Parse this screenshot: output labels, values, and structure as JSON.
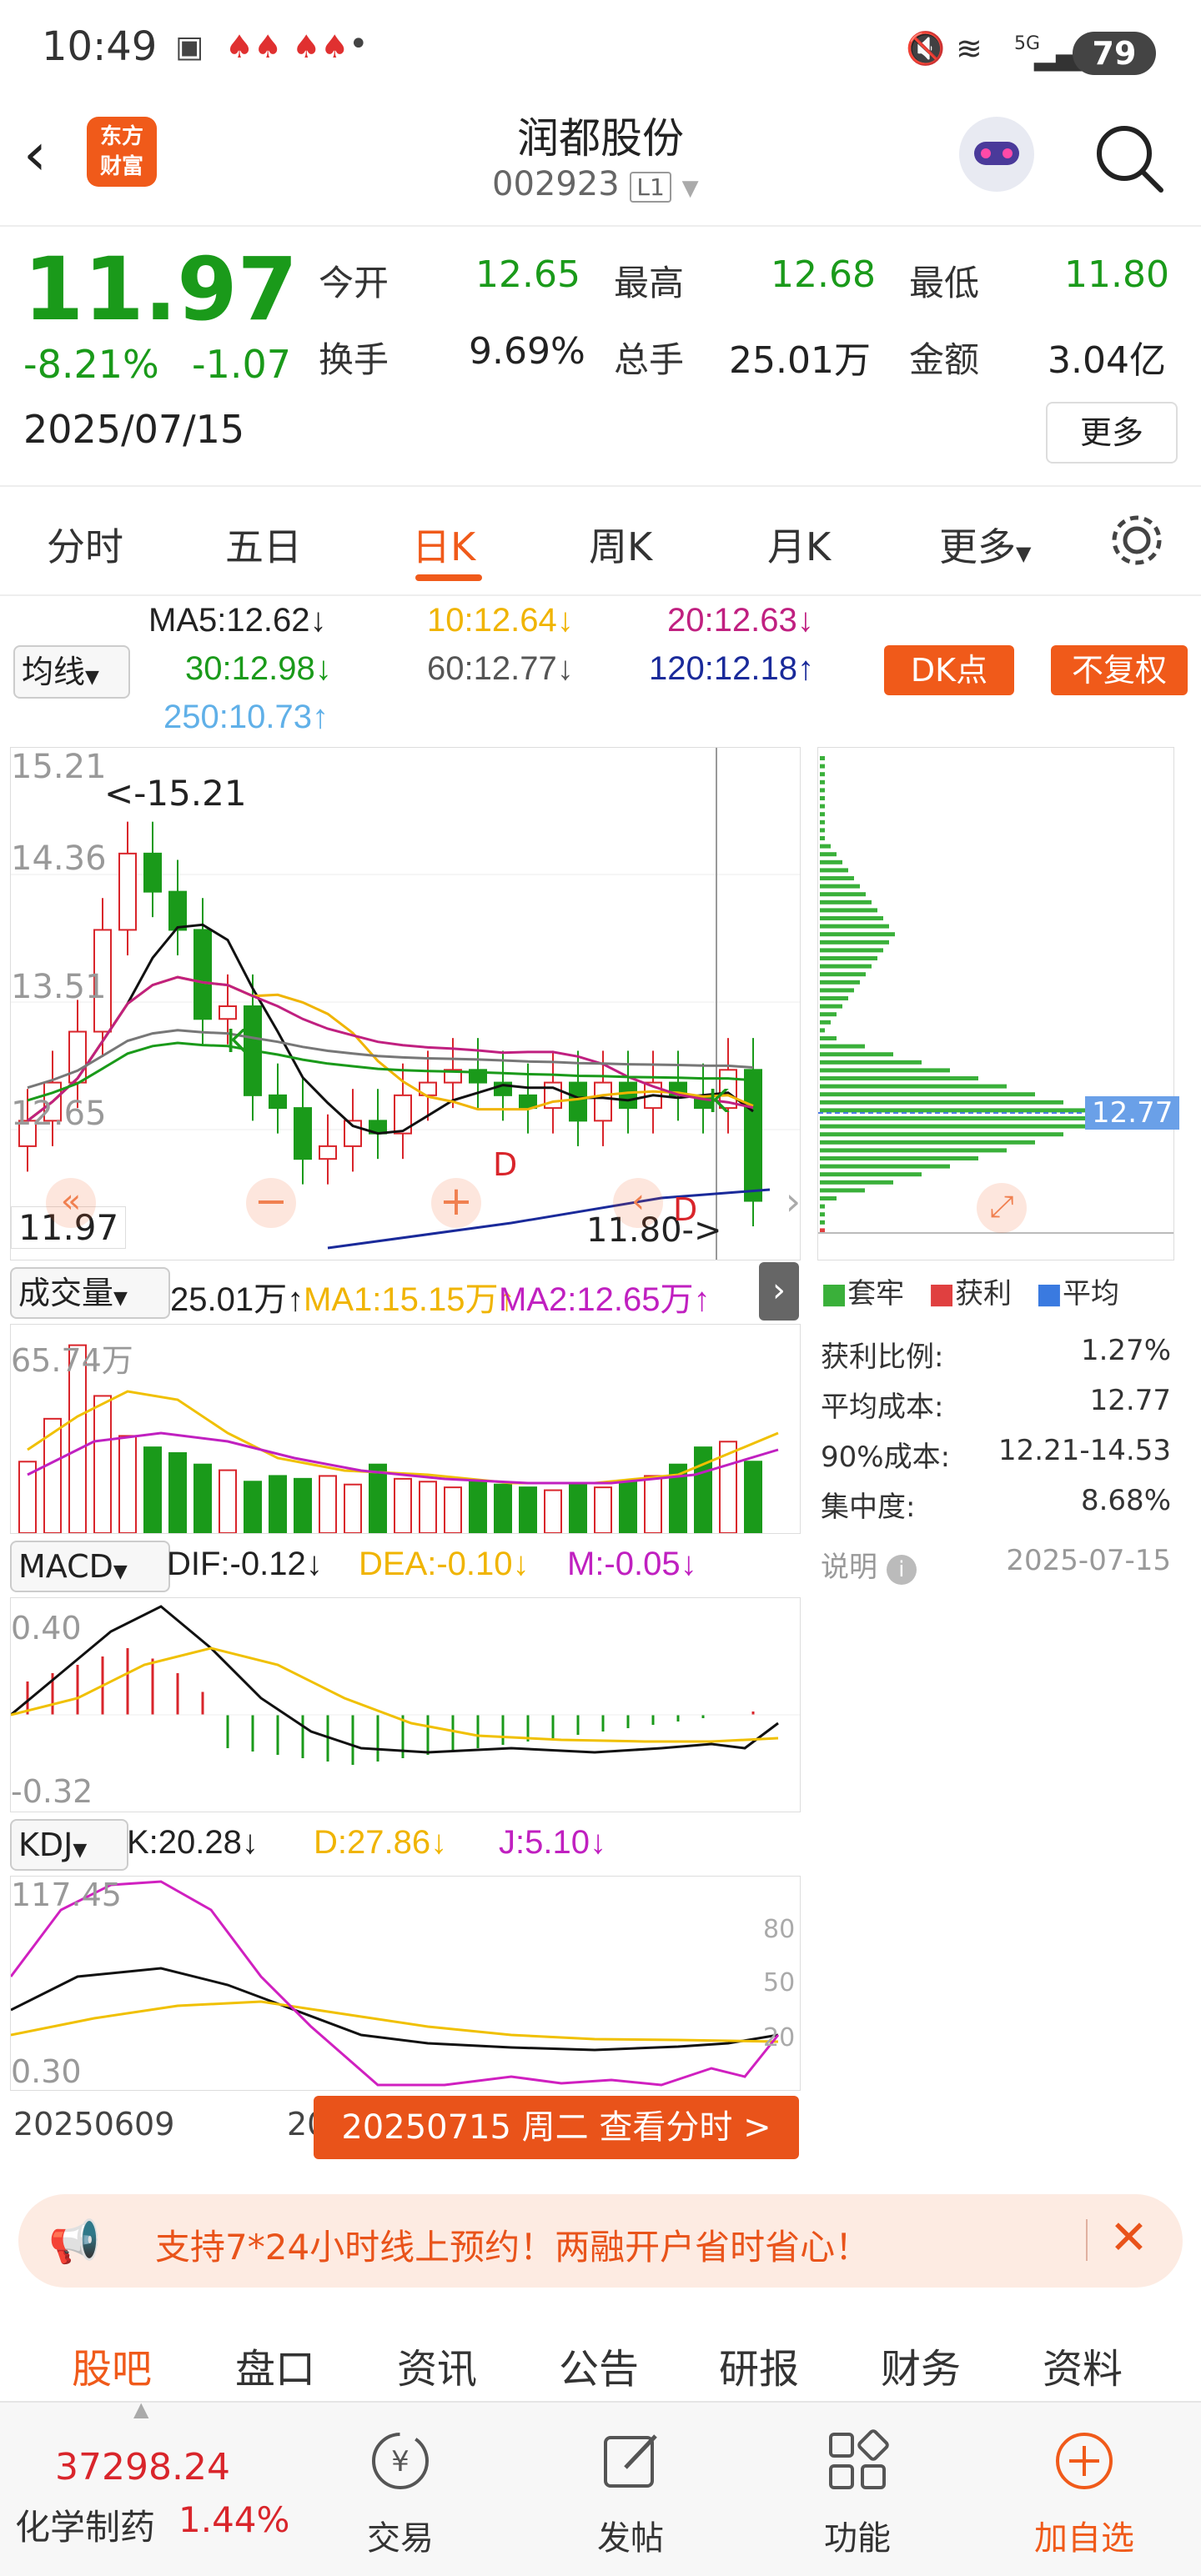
{
  "status_bar": {
    "time": "10:49",
    "battery": "79",
    "network": "5G"
  },
  "header": {
    "title": "润都股份",
    "code": "002923",
    "level": "L1",
    "logo_line1": "东方",
    "logo_line2": "财富"
  },
  "quote": {
    "price": "11.97",
    "change_pct": "-8.21%",
    "change": "-1.07",
    "date": "2025/07/15",
    "open_label": "今开",
    "open": "12.65",
    "high_label": "最高",
    "high": "12.68",
    "low_label": "最低",
    "low": "11.80",
    "turnover_label": "换手",
    "turnover": "9.69%",
    "volume_label": "总手",
    "volume": "25.01万",
    "amount_label": "金额",
    "amount": "3.04亿",
    "more": "更多"
  },
  "period_tabs": [
    "分时",
    "五日",
    "日K",
    "周K",
    "月K",
    "更多"
  ],
  "active_period": "日K",
  "ma": {
    "selector": "均线",
    "ma5": "MA5:12.62↓",
    "ma10": "10:12.64↓",
    "ma20": "20:12.63↓",
    "ma30": "30:12.98↓",
    "ma60": "60:12.77↓",
    "ma120": "120:12.18↑",
    "ma250": "250:10.73↑",
    "dk_button": "DK点",
    "adjust_button": "不复权"
  },
  "kline": {
    "y_labels": [
      "15.21",
      "14.36",
      "13.51",
      "12.65"
    ],
    "max_marker": "<-15.21",
    "min_marker": "11.80->",
    "current_price": "11.97",
    "markers": [
      "K",
      "D",
      "D",
      "K"
    ]
  },
  "volume": {
    "selector": "成交量",
    "value": "25.01万↑",
    "ma1": "MA1:15.15万↑",
    "ma2": "MA2:12.65万↑",
    "max_label": "65.74万"
  },
  "macd": {
    "selector": "MACD",
    "dif": "DIF:-0.12↓",
    "dea": "DEA:-0.10↓",
    "m": "M:-0.05↓",
    "top": "0.40",
    "bottom": "-0.32"
  },
  "kdj": {
    "selector": "KDJ",
    "k": "K:20.28↓",
    "d": "D:27.86↓",
    "j": "J:5.10↓",
    "top": "117.45",
    "bottom": "0.30",
    "levels": [
      "80",
      "50",
      "20"
    ]
  },
  "dates": {
    "start": "20250609",
    "mid_partial": "20",
    "selected_button": "20250715 周二 查看分时 >"
  },
  "chips": {
    "avg_marker": "12.77",
    "legend": [
      "套牢",
      "获利",
      "平均"
    ],
    "rows": [
      {
        "label": "获利比例:",
        "value": "1.27%"
      },
      {
        "label": "平均成本:",
        "value": "12.77"
      },
      {
        "label": "90%成本:",
        "value": "12.21-14.53"
      },
      {
        "label": "集中度:",
        "value": "8.68%"
      }
    ],
    "note_label": "说明",
    "note_date": "2025-07-15"
  },
  "banner": {
    "text": "支持7*24小时线上预约！两融开户省时省心！"
  },
  "info_tabs": [
    "股吧",
    "盘口",
    "资讯",
    "公告",
    "研报",
    "财务",
    "资料"
  ],
  "bottom_nav": {
    "index_value": "37298.24",
    "index_name": "化学制药",
    "index_pct": "1.44%",
    "items": [
      "交易",
      "发帖",
      "功能",
      "加自选"
    ]
  },
  "colors": {
    "accent": "#f05a1a",
    "up": "#d9252b",
    "down": "#1a9a1a"
  },
  "chart_data": {
    "type": "candlestick",
    "x_range": [
      "20250609",
      "20250715"
    ],
    "close": [
      12.6,
      12.9,
      13.3,
      14.1,
      14.7,
      14.4,
      14.1,
      13.4,
      13.5,
      12.8,
      12.7,
      12.3,
      12.4,
      12.6,
      12.5,
      12.8,
      12.9,
      13.0,
      12.9,
      12.8,
      12.7,
      12.9,
      12.6,
      12.9,
      12.7,
      12.9,
      12.8,
      12.7,
      13.0,
      11.97
    ],
    "volume_wan": [
      25,
      40,
      65.74,
      48,
      34,
      30,
      28,
      24,
      22,
      18,
      20,
      19,
      20,
      17,
      24,
      19,
      18,
      16,
      18,
      17,
      16,
      15,
      17,
      16,
      18,
      20,
      24,
      30,
      32,
      25.01
    ]
  }
}
